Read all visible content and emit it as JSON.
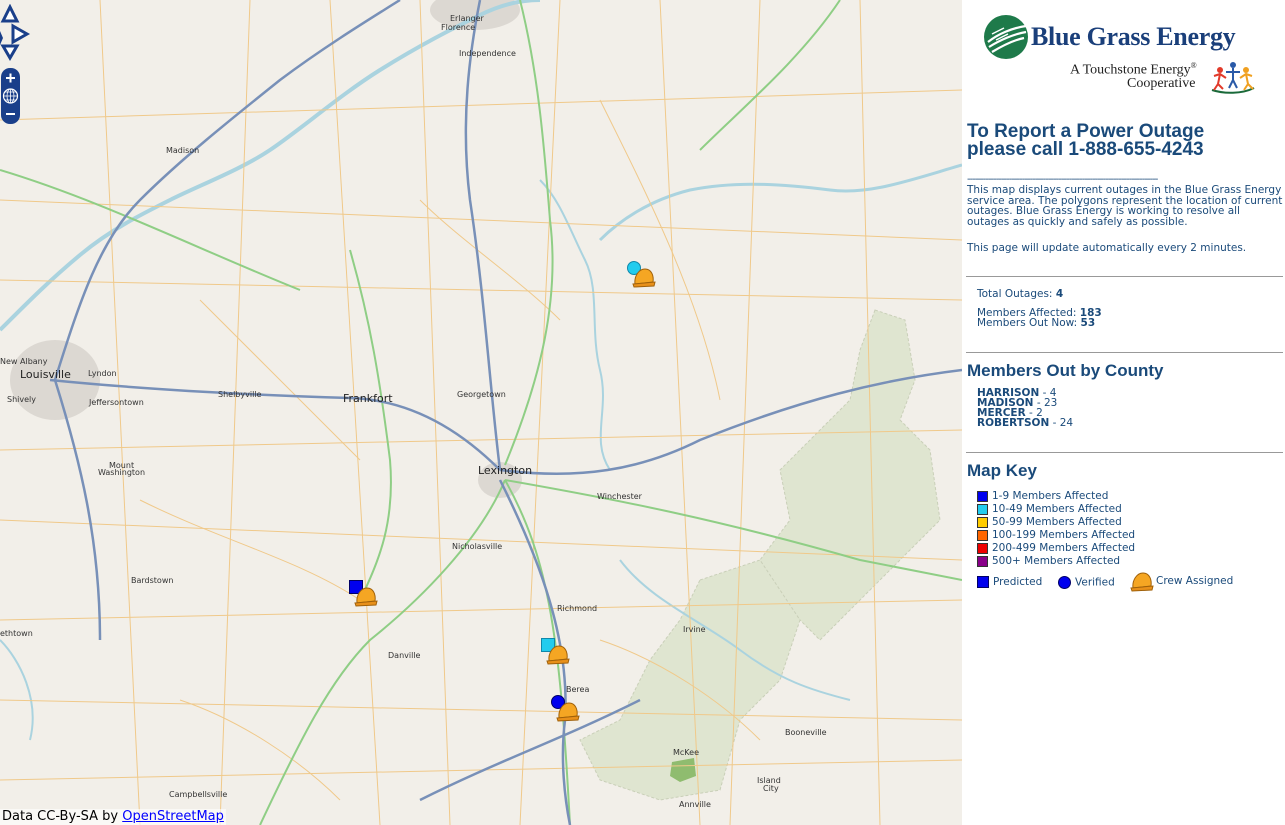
{
  "map": {
    "places": [
      {
        "name": "Erlanger",
        "size": "sm"
      },
      {
        "name": "Florence",
        "size": "sm"
      },
      {
        "name": "Independence",
        "size": "sm"
      },
      {
        "name": "Madison",
        "size": "sm"
      },
      {
        "name": "New Albany",
        "size": "sm"
      },
      {
        "name": "Louisville",
        "size": "lg"
      },
      {
        "name": "Lyndon",
        "size": "sm"
      },
      {
        "name": "Shively",
        "size": "sm"
      },
      {
        "name": "Jeffersontown",
        "size": "sm"
      },
      {
        "name": "Shelbyville",
        "size": "sm"
      },
      {
        "name": "Frankfort",
        "size": "lg"
      },
      {
        "name": "Georgetown",
        "size": "sm"
      },
      {
        "name": "Lexington",
        "size": "lg"
      },
      {
        "name": "Mount",
        "size": "sm"
      },
      {
        "name": "Washington",
        "size": "sm"
      },
      {
        "name": "Winchester",
        "size": "sm"
      },
      {
        "name": "Nicholasville",
        "size": "sm"
      },
      {
        "name": "Bardstown",
        "size": "sm"
      },
      {
        "name": "Richmond",
        "size": "sm"
      },
      {
        "name": "Irvine",
        "size": "sm"
      },
      {
        "name": "ethtown",
        "size": "sm"
      },
      {
        "name": "Danville",
        "size": "sm"
      },
      {
        "name": "Berea",
        "size": "sm"
      },
      {
        "name": "McKee",
        "size": "sm"
      },
      {
        "name": "Booneville",
        "size": "sm"
      },
      {
        "name": "Island",
        "size": "sm"
      },
      {
        "name": "City",
        "size": "sm"
      },
      {
        "name": "Campbellsville",
        "size": "sm"
      },
      {
        "name": "Annville",
        "size": "sm"
      }
    ],
    "attribution_prefix": "Data CC-By-SA by ",
    "attribution_link": "OpenStreetMap"
  },
  "panel": {
    "logo_title": "Blue Grass Energy",
    "logo_sub1": "A Touchstone Energy",
    "logo_sub1_mark": "®",
    "logo_sub2": "Cooperative",
    "headline_line1": "To Report a Power Outage",
    "headline_line2": "please call 1-888-655-4243",
    "dashes": "-------------------------------------------------------------------------",
    "description": "This map displays current outages in the Blue Grass Energy service area. The polygons represent the location of current outages. Blue Grass Energy is working to resolve all outages as quickly and safely as possible.",
    "update_note": "This page will update automatically every 2 minutes.",
    "stats": {
      "total_label": "Total Outages: ",
      "total_value": "4",
      "affected_label": "Members Affected: ",
      "affected_value": "183",
      "out_now_label": "Members Out Now: ",
      "out_now_value": "53"
    },
    "county_title": "Members Out by County",
    "counties": [
      {
        "name": "HARRISON",
        "value": " - 4"
      },
      {
        "name": "MADISON",
        "value": " - 23"
      },
      {
        "name": "MERCER",
        "value": " - 2"
      },
      {
        "name": "ROBERTSON",
        "value": " - 24"
      }
    ],
    "key_title": "Map Key",
    "key_items": [
      {
        "label": "1-9 Members Affected",
        "color": "#0000ee"
      },
      {
        "label": "10-49 Members Affected",
        "color": "#22ccee"
      },
      {
        "label": "50-99 Members Affected",
        "color": "#ffcc00"
      },
      {
        "label": "100-199 Members Affected",
        "color": "#ff6600"
      },
      {
        "label": "200-499 Members Affected",
        "color": "#ee0000"
      },
      {
        "label": "500+ Members Affected",
        "color": "#880088"
      }
    ],
    "legend": {
      "predicted": "Predicted",
      "verified": "Verified",
      "crew": "Crew Assigned"
    }
  }
}
